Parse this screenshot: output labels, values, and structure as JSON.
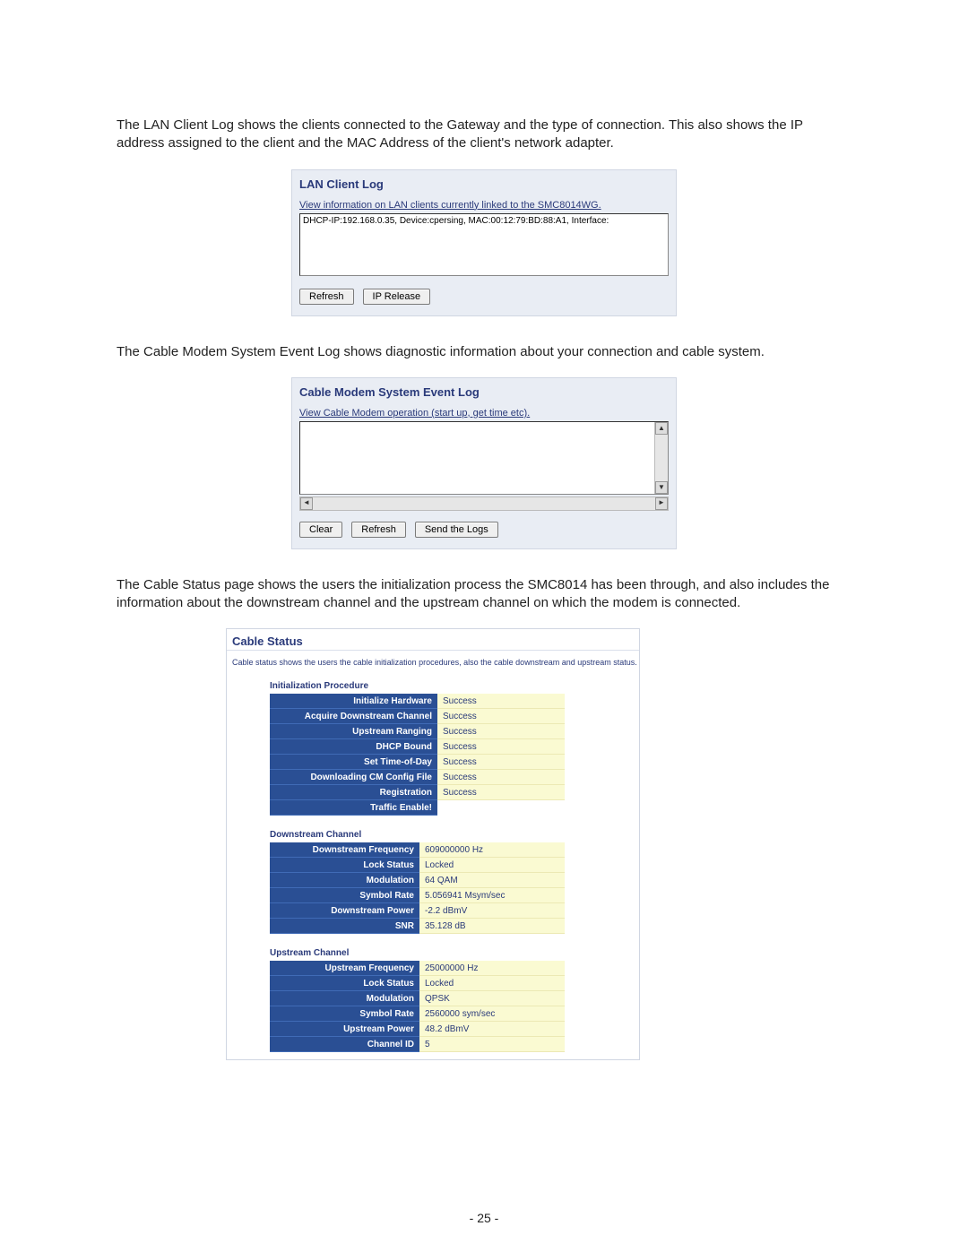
{
  "paragraphs": {
    "p1": "The LAN Client Log shows the clients connected to the Gateway and the type of connection. This also shows the IP address assigned to the client and the MAC Address of the client's network adapter.",
    "p2": "The Cable Modem System Event Log shows diagnostic information about your connection and cable system.",
    "p3": "The Cable Status page shows the users the initialization process the SMC8014 has been through, and also includes the information about the downstream channel and the upstream channel on which the modem is connected."
  },
  "lan_log": {
    "title": "LAN Client Log",
    "subtitle": "View information on LAN clients currently linked to the SMC8014WG.",
    "entry": "DHCP-IP:192.168.0.35, Device:cpersing, MAC:00:12:79:BD:88:A1, Interface:",
    "buttons": {
      "refresh": "Refresh",
      "ip_release": "IP Release"
    }
  },
  "event_log": {
    "title": "Cable Modem System Event Log",
    "subtitle": "View Cable Modem operation (start up, get time etc).",
    "buttons": {
      "clear": "Clear",
      "refresh": "Refresh",
      "send": "Send the Logs"
    }
  },
  "cable_status": {
    "title": "Cable Status",
    "description": "Cable status shows the users the cable initialization procedures, also the cable downstream and upstream status.",
    "sections": {
      "init": {
        "heading": "Initialization Procedure",
        "rows": [
          {
            "label": "Initialize Hardware",
            "value": "Success"
          },
          {
            "label": "Acquire Downstream Channel",
            "value": "Success"
          },
          {
            "label": "Upstream Ranging",
            "value": "Success"
          },
          {
            "label": "DHCP Bound",
            "value": "Success"
          },
          {
            "label": "Set Time-of-Day",
            "value": "Success"
          },
          {
            "label": "Downloading CM Config File",
            "value": "Success"
          },
          {
            "label": "Registration",
            "value": "Success"
          },
          {
            "label": "Traffic Enable!",
            "value": ""
          }
        ]
      },
      "downstream": {
        "heading": "Downstream Channel",
        "rows": [
          {
            "label": "Downstream Frequency",
            "value": "609000000 Hz"
          },
          {
            "label": "Lock Status",
            "value": "Locked"
          },
          {
            "label": "Modulation",
            "value": "64 QAM"
          },
          {
            "label": "Symbol Rate",
            "value": "5.056941 Msym/sec"
          },
          {
            "label": "Downstream Power",
            "value": "-2.2 dBmV"
          },
          {
            "label": "SNR",
            "value": "35.128 dB"
          }
        ]
      },
      "upstream": {
        "heading": "Upstream Channel",
        "rows": [
          {
            "label": "Upstream Frequency",
            "value": "25000000 Hz"
          },
          {
            "label": "Lock Status",
            "value": "Locked"
          },
          {
            "label": "Modulation",
            "value": "QPSK"
          },
          {
            "label": "Symbol Rate",
            "value": "2560000 sym/sec"
          },
          {
            "label": "Upstream Power",
            "value": "48.2 dBmV"
          },
          {
            "label": "Channel ID",
            "value": "5"
          }
        ]
      }
    }
  },
  "page_number": "- 25 -"
}
